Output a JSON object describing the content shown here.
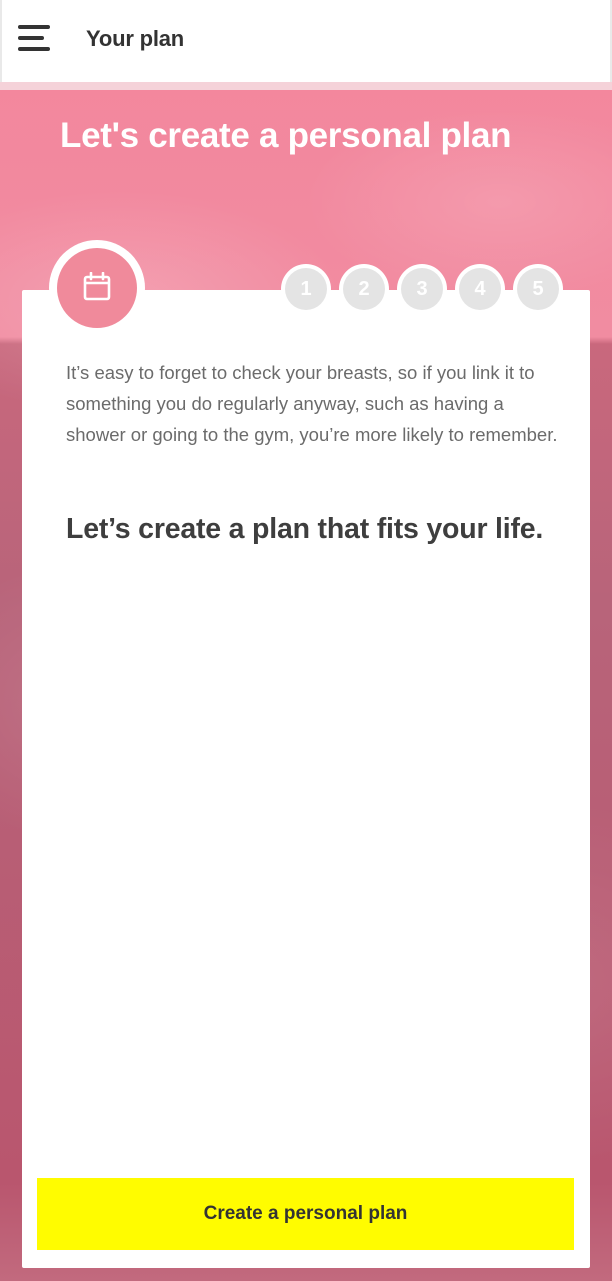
{
  "app_bar": {
    "title": "Your plan",
    "menu_icon": "hamburger-menu-icon"
  },
  "hero": {
    "title": "Let's create a personal plan"
  },
  "card": {
    "header_icon": "calendar-icon",
    "steps": [
      "1",
      "2",
      "3",
      "4",
      "5"
    ],
    "body": "It’s easy to forget to check your breasts, so if you link it to something you do regularly anyway, such as having a shower or going to the gym, you’re more likely to remember.",
    "heading": "Let’s create a plan that fits your life."
  },
  "cta": {
    "label": "Create a personal plan"
  },
  "colors": {
    "header_pink": "#f3879d",
    "accent_pink": "#f08a9b",
    "cta_yellow": "#fffc00",
    "step_inactive": "#e4e4e4"
  }
}
